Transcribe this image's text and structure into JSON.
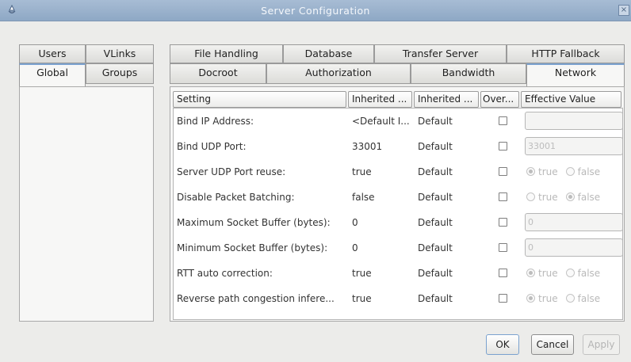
{
  "window": {
    "title": "Server Configuration",
    "close_glyph": "×"
  },
  "left_tabs": {
    "row1": [
      "Users",
      "VLinks"
    ],
    "row2": [
      "Global",
      "Groups"
    ],
    "active": "Global"
  },
  "right_tabs": {
    "row1": [
      "File Handling",
      "Database",
      "Transfer Server",
      "HTTP Fallback"
    ],
    "row2": [
      "Docroot",
      "Authorization",
      "Bandwidth",
      "Network"
    ],
    "active": "Network"
  },
  "table": {
    "columns": [
      "Setting",
      "Inherited ...",
      "Inherited ...",
      "Over...",
      "Effective Value"
    ],
    "rows": [
      {
        "setting": "Bind IP Address:",
        "inherited_value": "<Default I...",
        "inherited_from": "Default",
        "override": false,
        "effective": {
          "type": "text",
          "value": ""
        }
      },
      {
        "setting": "Bind UDP Port:",
        "inherited_value": "33001",
        "inherited_from": "Default",
        "override": false,
        "effective": {
          "type": "text",
          "value": "33001"
        }
      },
      {
        "setting": "Server UDP Port reuse:",
        "inherited_value": "true",
        "inherited_from": "Default",
        "override": false,
        "effective": {
          "type": "radio",
          "options": [
            "true",
            "false"
          ],
          "selected": "true"
        }
      },
      {
        "setting": "Disable Packet Batching:",
        "inherited_value": "false",
        "inherited_from": "Default",
        "override": false,
        "effective": {
          "type": "radio",
          "options": [
            "true",
            "false"
          ],
          "selected": "false"
        }
      },
      {
        "setting": "Maximum Socket Buffer (bytes):",
        "inherited_value": "0",
        "inherited_from": "Default",
        "override": false,
        "effective": {
          "type": "text",
          "value": "0"
        }
      },
      {
        "setting": "Minimum Socket Buffer (bytes):",
        "inherited_value": "0",
        "inherited_from": "Default",
        "override": false,
        "effective": {
          "type": "text",
          "value": "0"
        }
      },
      {
        "setting": "RTT auto correction:",
        "inherited_value": "true",
        "inherited_from": "Default",
        "override": false,
        "effective": {
          "type": "radio",
          "options": [
            "true",
            "false"
          ],
          "selected": "true"
        }
      },
      {
        "setting": "Reverse path congestion infere...",
        "inherited_value": "true",
        "inherited_from": "Default",
        "override": false,
        "effective": {
          "type": "radio",
          "options": [
            "true",
            "false"
          ],
          "selected": "true"
        }
      }
    ]
  },
  "buttons": {
    "ok": "OK",
    "cancel": "Cancel",
    "apply": "Apply"
  },
  "colors": {
    "titlebar": "#97afca",
    "active_tab_accent": "#7ba2cf",
    "panel_bg": "#f7f7f6",
    "window_bg": "#ececea"
  }
}
